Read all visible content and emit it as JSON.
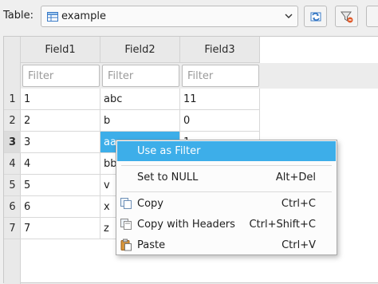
{
  "toolbar": {
    "table_label": "Table:",
    "table_value": "example"
  },
  "grid": {
    "columns": [
      "Field1",
      "Field2",
      "Field3"
    ],
    "filter_placeholder": "Filter",
    "rows": [
      {
        "num": "1",
        "cells": [
          "1",
          "abc",
          "11"
        ]
      },
      {
        "num": "2",
        "cells": [
          "2",
          "b",
          "0"
        ]
      },
      {
        "num": "3",
        "cells": [
          "3",
          "aa",
          "1"
        ]
      },
      {
        "num": "4",
        "cells": [
          "4",
          "bb",
          ""
        ]
      },
      {
        "num": "5",
        "cells": [
          "5",
          "v",
          ""
        ]
      },
      {
        "num": "6",
        "cells": [
          "6",
          "x",
          ""
        ]
      },
      {
        "num": "7",
        "cells": [
          "7",
          "z",
          ""
        ]
      }
    ],
    "selected_row": 3,
    "selected_column": "Field2"
  },
  "context_menu": {
    "use_as_filter": "Use as Filter",
    "set_null": "Set to NULL",
    "set_null_shortcut": "Alt+Del",
    "copy": "Copy",
    "copy_shortcut": "Ctrl+C",
    "copy_headers": "Copy with Headers",
    "copy_headers_shortcut": "Ctrl+Shift+C",
    "paste": "Paste",
    "paste_shortcut": "Ctrl+V"
  },
  "icons": {
    "table": "table-icon",
    "dropdown": "chevron-down-icon",
    "refresh": "refresh-icon",
    "clear_filters": "clear-filter-icon",
    "copy": "copy-icon",
    "copy_headers": "copy-with-headers-icon",
    "paste": "paste-icon"
  },
  "colors": {
    "selection": "#3daee9",
    "window_bg": "#efefef"
  }
}
